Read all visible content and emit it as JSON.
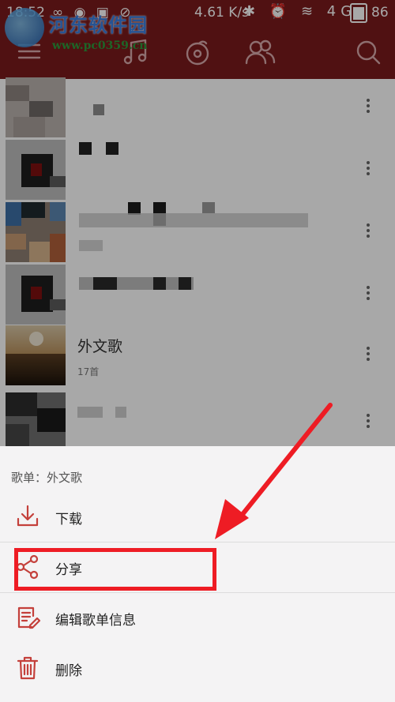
{
  "status_bar": {
    "time": "18:52",
    "left_icons": "∞ ◉ ▣ ⊘",
    "speed": "4.61 K/s",
    "right_icons": "✱ ⏰ ≋ 4G",
    "battery": "86"
  },
  "watermark": {
    "title": "河东软件园",
    "url": "www.pc0359.cn"
  },
  "header_icons": [
    "menu-icon",
    "music-note-icon",
    "disc-icon",
    "users-icon",
    "search-icon"
  ],
  "playlists": [
    {
      "title": "",
      "count": "",
      "censored": true
    },
    {
      "title": "",
      "count": "",
      "censored": true
    },
    {
      "title": "",
      "count": "",
      "censored": true
    },
    {
      "title": "",
      "count": "",
      "censored": true
    },
    {
      "title": "外文歌",
      "count": "17首",
      "censored": false
    },
    {
      "title": "",
      "count": "",
      "censored": true
    }
  ],
  "sheet": {
    "header": "歌单：外文歌",
    "items": [
      {
        "label": "下载",
        "icon": "download-icon"
      },
      {
        "label": "分享",
        "icon": "share-icon"
      },
      {
        "label": "编辑歌单信息",
        "icon": "edit-icon"
      },
      {
        "label": "删除",
        "icon": "trash-icon"
      }
    ]
  },
  "colors": {
    "header": "#7a1a1c",
    "accent": "#c4403b",
    "annotation": "#ee1c24"
  }
}
